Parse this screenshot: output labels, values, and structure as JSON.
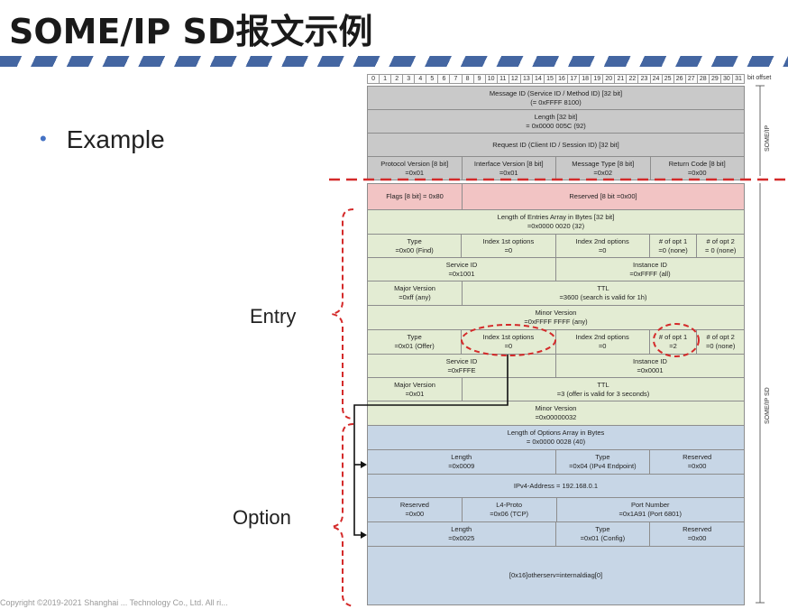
{
  "title": "SOME/IP SD报文示例",
  "bullet": "Example",
  "labels": {
    "entry": "Entry",
    "option": "Option"
  },
  "bits": [
    "0",
    "1",
    "2",
    "3",
    "4",
    "5",
    "6",
    "7",
    "8",
    "9",
    "10",
    "11",
    "12",
    "13",
    "14",
    "15",
    "16",
    "17",
    "18",
    "19",
    "20",
    "21",
    "22",
    "23",
    "24",
    "25",
    "26",
    "27",
    "28",
    "29",
    "30",
    "31"
  ],
  "bit_offset": "bit offset",
  "side_labels": {
    "someip": "SOME/IP",
    "someip_sd": "SOME/IP SD"
  },
  "header": {
    "message_id": [
      "Message ID (Service ID / Method ID) [32 bit]",
      "(= 0xFFFF 8100)"
    ],
    "length": [
      "Length [32 bit]",
      "= 0x0000 005C (92)"
    ],
    "request_id": [
      "Request ID (Client ID / Session ID) [32 bit]"
    ],
    "protocol_version": [
      "Protocol Version [8 bit]",
      "=0x01"
    ],
    "interface_version": [
      "Interface Version [8 bit]",
      "=0x01"
    ],
    "message_type": [
      "Message Type [8 bit]",
      "=0x02"
    ],
    "return_code": [
      "Return Code [8 bit]",
      "=0x00"
    ]
  },
  "sd": {
    "flags": [
      "Flags [8 bit] = 0x80"
    ],
    "reserved": [
      "Reserved [8 bit =0x00]"
    ],
    "entries_len": [
      "Length of Entries Array in Bytes [32 bit]",
      "=0x0000 0020 (32)"
    ]
  },
  "entry1": {
    "type": [
      "Type",
      "=0x00 (Find)"
    ],
    "idx1": [
      "Index 1st options",
      "=0"
    ],
    "idx2": [
      "Index 2nd options",
      "=0"
    ],
    "opt1": [
      "# of opt 1",
      "=0 (none)"
    ],
    "opt2": [
      "# of opt 2",
      "= 0 (none)"
    ],
    "service_id": [
      "Service ID",
      "=0x1001"
    ],
    "instance_id": [
      "Instance ID",
      "=0xFFFF (all)"
    ],
    "major": [
      "Major Version",
      "=0xff (any)"
    ],
    "ttl": [
      "TTL",
      "=3600 (search is valid for 1h)"
    ],
    "minor": [
      "Minor Version",
      "=0xFFFF FFFF (any)"
    ]
  },
  "entry2": {
    "type": [
      "Type",
      "=0x01 (Offer)"
    ],
    "idx1": [
      "Index 1st options",
      "=0"
    ],
    "idx2": [
      "Index 2nd options",
      "=0"
    ],
    "opt1": [
      "# of opt 1",
      "=2"
    ],
    "opt2": [
      "# of opt 2",
      "=0 (none)"
    ],
    "service_id": [
      "Service ID",
      "=0xFFFE"
    ],
    "instance_id": [
      "Instance ID",
      "=0x0001"
    ],
    "major": [
      "Major Version",
      "=0x01"
    ],
    "ttl": [
      "TTL",
      "=3 (offer is valid for 3 seconds)"
    ],
    "minor": [
      "Minor Version",
      "=0x00000032"
    ]
  },
  "options": {
    "len": [
      "Length of Options Array  in Bytes",
      "= 0x0000 0028 (40)"
    ],
    "o1_length": [
      "Length",
      "=0x0009"
    ],
    "o1_type": [
      "Type",
      "=0x04 (IPv4 Endpoint)"
    ],
    "o1_reserved": [
      "Reserved",
      "=0x00"
    ],
    "ipv4": [
      "IPv4-Address = 192.168.0.1"
    ],
    "o1_reserved2": [
      "Reserved",
      "=0x00"
    ],
    "l4proto": [
      "L4-Proto",
      "=0x06 (TCP)"
    ],
    "port": [
      "Port Number",
      "=0x1A91 (Port 6801)"
    ],
    "o2_length": [
      "Length",
      "=0x0025"
    ],
    "o2_type": [
      "Type",
      "=0x01 (Config)"
    ],
    "o2_reserved": [
      "Reserved",
      "=0x00"
    ],
    "config": [
      "[0x16]otherserv=internaldiag[0]"
    ]
  },
  "footer": "Copyright ©2019-2021 Shanghai ... Technology Co., Ltd. All ri..."
}
